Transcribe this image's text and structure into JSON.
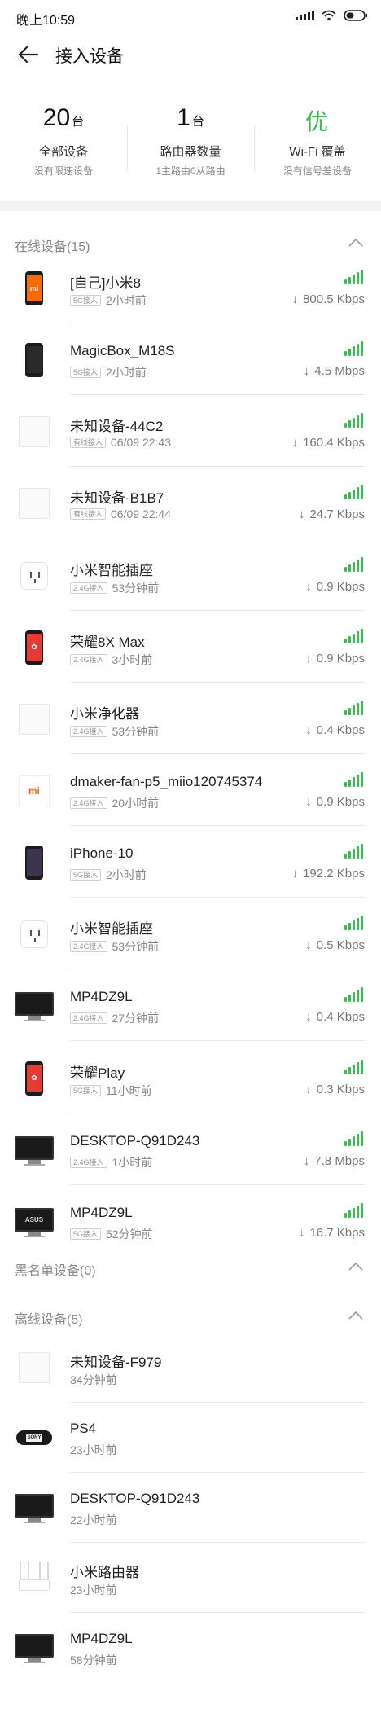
{
  "status_bar": {
    "time": "晚上10:59",
    "icons": [
      "signal-icon",
      "wifi-icon",
      "battery-icon"
    ]
  },
  "header": {
    "title": "接入设备",
    "back_icon": "back-arrow-icon"
  },
  "stats": [
    {
      "value": "20",
      "unit": "台",
      "label": "全部设备",
      "sub": "没有限速设备"
    },
    {
      "value": "1",
      "unit": "台",
      "label": "路由器数量",
      "sub": "1主路由0从路由"
    },
    {
      "value": "优",
      "unit": "",
      "label": "Wi-Fi 覆盖",
      "sub": "没有信号差设备"
    }
  ],
  "online": {
    "title": "在线设备(15)",
    "devices": [
      {
        "icon": "xiaomi-phone-icon",
        "name": "[自己]小米8",
        "tag": "5G接入",
        "time": "2小时前",
        "speed": "800.5 Kbps"
      },
      {
        "icon": "phone-icon",
        "name": "MagicBox_M18S",
        "tag": "5G接入",
        "time": "2小时前",
        "speed": "4.5 Mbps"
      },
      {
        "icon": "unknown-device-icon",
        "name": "未知设备-44C2",
        "tag": "有线接入",
        "time": "06/09 22:43",
        "speed": "160.4 Kbps"
      },
      {
        "icon": "unknown-device-icon",
        "name": "未知设备-B1B7",
        "tag": "有线接入",
        "time": "06/09 22:44",
        "speed": "24.7 Kbps"
      },
      {
        "icon": "smart-plug-icon",
        "name": "小米智能插座",
        "tag": "2.4G接入",
        "time": "53分钟前",
        "speed": "0.9 Kbps"
      },
      {
        "icon": "huawei-phone-icon",
        "name": "荣耀8X Max",
        "tag": "2.4G接入",
        "time": "3小时前",
        "speed": "0.9 Kbps"
      },
      {
        "icon": "unknown-device-icon",
        "name": "小米净化器",
        "tag": "2.4G接入",
        "time": "53分钟前",
        "speed": "0.4 Kbps"
      },
      {
        "icon": "mi-device-icon",
        "name": "dmaker-fan-p5_miio120745374",
        "tag": "2.4G接入",
        "time": "20小时前",
        "speed": "0.9 Kbps"
      },
      {
        "icon": "iphone-icon",
        "name": "iPhone-10",
        "tag": "5G接入",
        "time": "2小时前",
        "speed": "192.2 Kbps"
      },
      {
        "icon": "smart-plug-icon",
        "name": "小米智能插座",
        "tag": "2.4G接入",
        "time": "53分钟前",
        "speed": "0.5 Kbps"
      },
      {
        "icon": "monitor-icon",
        "name": "MP4DZ9L",
        "tag": "2.4G接入",
        "time": "27分钟前",
        "speed": "0.4 Kbps"
      },
      {
        "icon": "huawei-phone-icon",
        "name": "荣耀Play",
        "tag": "5G接入",
        "time": "11小时前",
        "speed": "0.3 Kbps"
      },
      {
        "icon": "monitor-icon",
        "name": "DESKTOP-Q91D243",
        "tag": "2.4G接入",
        "time": "1小时前",
        "speed": "7.8 Mbps"
      },
      {
        "icon": "asus-monitor-icon",
        "name": "MP4DZ9L",
        "tag": "5G接入",
        "time": "52分钟前",
        "speed": "16.7 Kbps"
      }
    ]
  },
  "blacklist": {
    "title": "黑名单设备(0)"
  },
  "offline": {
    "title": "离线设备(5)",
    "devices": [
      {
        "icon": "unknown-device-icon",
        "name": "未知设备-F979",
        "time": "34分钟前"
      },
      {
        "icon": "game-console-icon",
        "name": "PS4",
        "time": "23小时前"
      },
      {
        "icon": "monitor-icon",
        "name": "DESKTOP-Q91D243",
        "time": "22小时前"
      },
      {
        "icon": "router-icon",
        "name": "小米路由器",
        "time": "23小时前"
      },
      {
        "icon": "monitor-icon",
        "name": "MP4DZ9L",
        "time": "58分钟前"
      }
    ]
  },
  "colors": {
    "accent_green": "#3fb957",
    "section_bg": "#f2f2f2",
    "muted_text": "#888888"
  }
}
